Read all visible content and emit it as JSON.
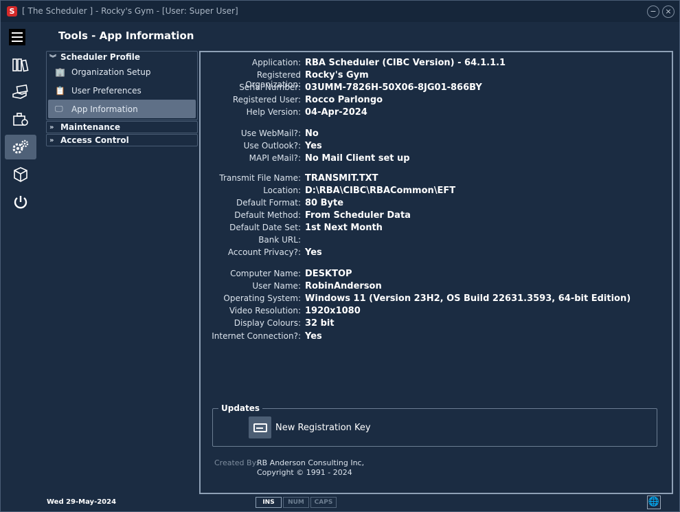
{
  "window": {
    "title": "[ The Scheduler ] - Rocky's Gym - [User: Super User]",
    "app_icon": "S",
    "minimize_glyph": "−",
    "close_glyph": "×"
  },
  "rail": {
    "items": [
      {
        "name": "schedules-books-icon",
        "glyph": "📚"
      },
      {
        "name": "payments-hand-icon",
        "glyph": "💸"
      },
      {
        "name": "briefcase-icon",
        "glyph": "💼"
      },
      {
        "name": "gears-icon",
        "glyph": "⚙"
      },
      {
        "name": "package-icon",
        "glyph": "📦"
      },
      {
        "name": "power-icon",
        "glyph": "⏻"
      }
    ],
    "active_index": 3
  },
  "page": {
    "title": "Tools - App Information"
  },
  "nav": {
    "groups": [
      {
        "label": "Scheduler Profile",
        "expanded": true,
        "items": [
          {
            "label": "Organization Setup",
            "icon": "building-icon"
          },
          {
            "label": "User Preferences",
            "icon": "clipboard-icon"
          },
          {
            "label": "App Information",
            "icon": "monitor-info-icon",
            "selected": true
          }
        ]
      },
      {
        "label": "Maintenance",
        "expanded": false
      },
      {
        "label": "Access Control",
        "expanded": false
      }
    ]
  },
  "info": {
    "application": {
      "label": "Application:",
      "value": "RBA Scheduler (CIBC Version) - 64.1.1.1"
    },
    "organization": {
      "label": "Registered Organization:",
      "value": "Rocky's Gym"
    },
    "serial": {
      "label": "Serial Number:",
      "value": "03UMM-7826H-50X06-8JG01-866BY"
    },
    "user": {
      "label": "Registered User:",
      "value": "Rocco Parlongo"
    },
    "help_version": {
      "label": "Help Version:",
      "value": "04-Apr-2024"
    },
    "webmail": {
      "label": "Use WebMail?:",
      "value": "No"
    },
    "outlook": {
      "label": "Use Outlook?:",
      "value": "Yes"
    },
    "mapi": {
      "label": "MAPI eMail?:",
      "value": "No Mail Client set up"
    },
    "transmit_file": {
      "label": "Transmit File Name:",
      "value": "TRANSMIT.TXT"
    },
    "location": {
      "label": "Location:",
      "value": "D:\\RBA\\CIBC\\RBACommon\\EFT"
    },
    "default_format": {
      "label": "Default Format:",
      "value": "80 Byte"
    },
    "default_method": {
      "label": "Default Method:",
      "value": "From Scheduler Data"
    },
    "default_date_set": {
      "label": "Default Date Set:",
      "value": "1st Next Month"
    },
    "bank_url": {
      "label": "Bank URL:",
      "value": ""
    },
    "account_privacy": {
      "label": "Account Privacy?:",
      "value": "Yes"
    },
    "computer_name": {
      "label": "Computer Name:",
      "value": "DESKTOP"
    },
    "user_name": {
      "label": "User Name:",
      "value": "RobinAnderson"
    },
    "os": {
      "label": "Operating System:",
      "value": "Windows 11 (Version 23H2, OS Build 22631.3593, 64-bit Edition)"
    },
    "video": {
      "label": "Video Resolution:",
      "value": "1920x1080"
    },
    "colours": {
      "label": "Display Colours:",
      "value": "32 bit"
    },
    "internet": {
      "label": "Internet Connection?:",
      "value": "Yes"
    }
  },
  "updates": {
    "title": "Updates",
    "button_label": "New Registration Key"
  },
  "footer": {
    "created_by": "Created By:",
    "company": "RB Anderson Consulting Inc,",
    "copyright": "Copyright © 1991 - 2024"
  },
  "status": {
    "date": "Wed  29-May-2024",
    "keys": [
      {
        "label": "INS",
        "on": true
      },
      {
        "label": "NUM",
        "on": false
      },
      {
        "label": "CAPS",
        "on": false
      }
    ],
    "globe_glyph": "🌐"
  },
  "colors": {
    "background": "#1b2c42",
    "titlebar": "#16263a",
    "selected": "#5f7087",
    "border": "#8fa1b6",
    "app_icon": "#d42a2a"
  }
}
